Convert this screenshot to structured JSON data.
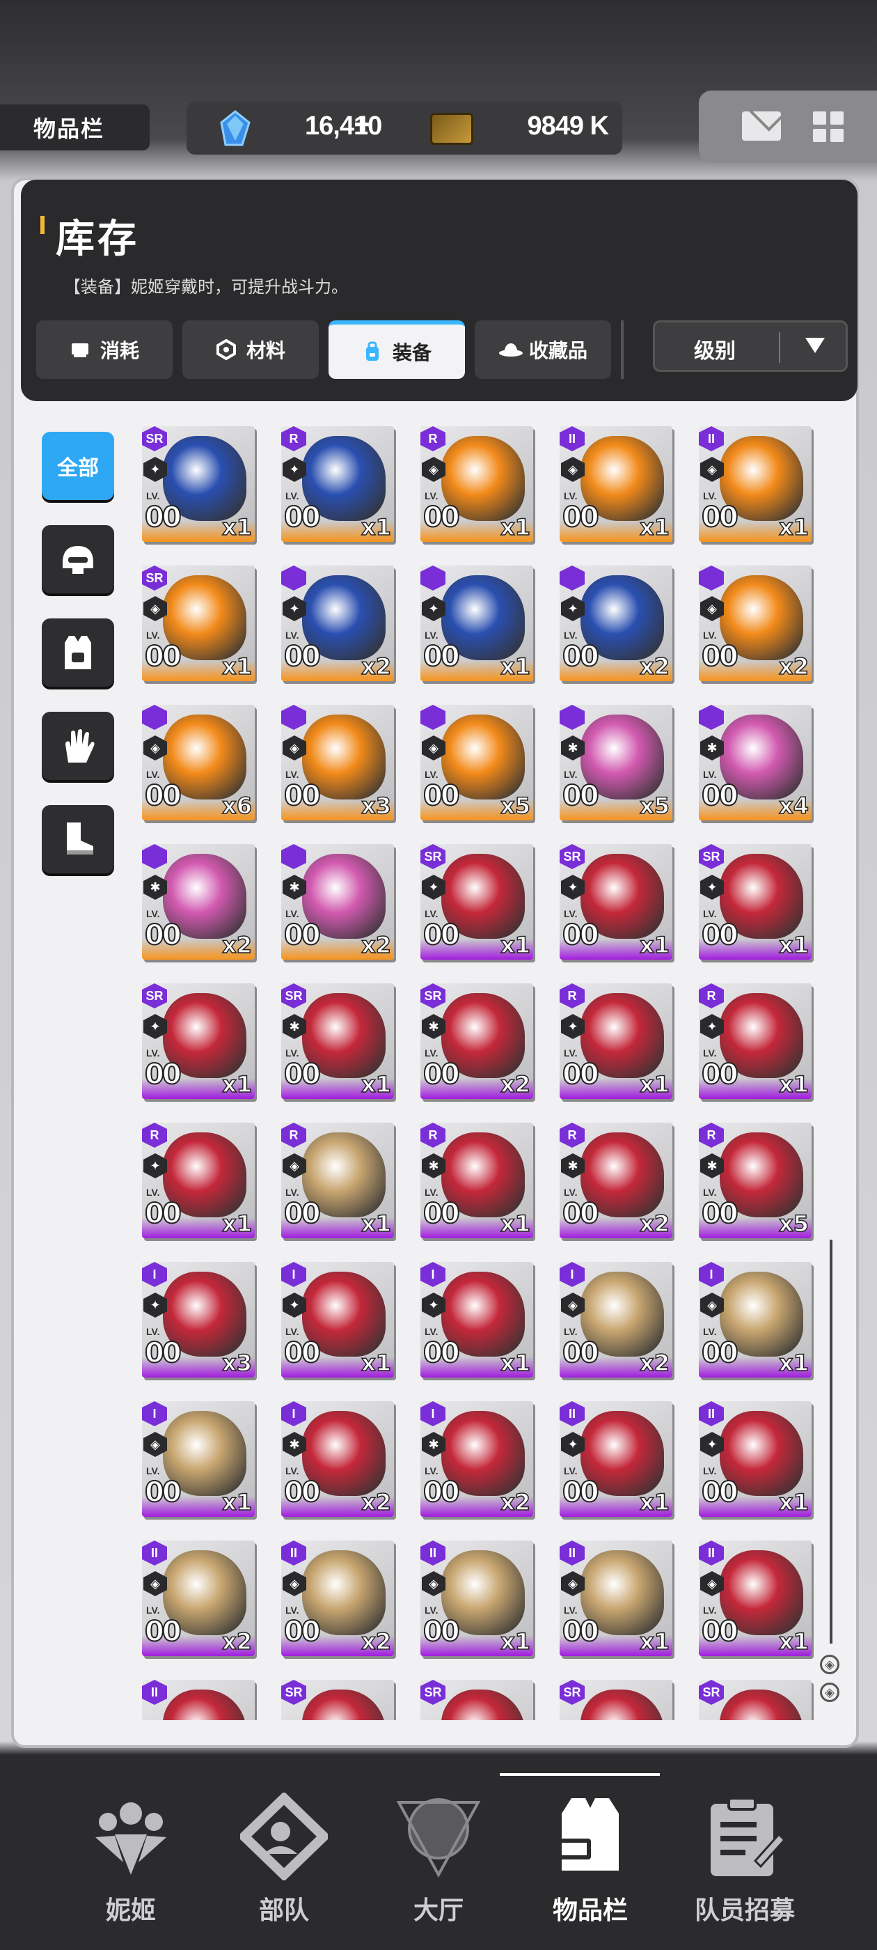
{
  "header": {
    "page_label": "物品栏",
    "gems": "16,410",
    "gems_plus": "+",
    "tickets": "9849 K"
  },
  "inventory": {
    "title": "库存",
    "description": "【装备】妮姬穿戴时，可提升战斗力。",
    "tabs": [
      {
        "label": "消耗",
        "icon": "consumable-icon",
        "active": false
      },
      {
        "label": "材料",
        "icon": "hexagon-icon",
        "active": false
      },
      {
        "label": "装备",
        "icon": "backpack-icon",
        "active": true
      },
      {
        "label": "收藏品",
        "icon": "hat-icon",
        "active": false
      }
    ],
    "sort_label": "级别"
  },
  "side_filters": [
    {
      "label": "全部",
      "icon": "",
      "active": true
    },
    {
      "label": "",
      "icon": "helmet-icon",
      "active": false
    },
    {
      "label": "",
      "icon": "vest-icon",
      "active": false
    },
    {
      "label": "",
      "icon": "glove-icon",
      "active": false
    },
    {
      "label": "",
      "icon": "boot-icon",
      "active": false
    }
  ],
  "items": [
    {
      "rarity": "orange",
      "rank": "SR",
      "cls": "✦",
      "lv": "LV.",
      "level": "00",
      "count": "x1",
      "color": "#2a4fb0"
    },
    {
      "rarity": "orange",
      "rank": "R",
      "cls": "✦",
      "lv": "LV.",
      "level": "00",
      "count": "x1",
      "color": "#2a4fb0"
    },
    {
      "rarity": "orange",
      "rank": "R",
      "cls": "◈",
      "lv": "LV.",
      "level": "00",
      "count": "x1",
      "color": "#f28a1a"
    },
    {
      "rarity": "orange",
      "rank": "II",
      "cls": "◈",
      "lv": "LV.",
      "level": "00",
      "count": "x1",
      "color": "#f28a1a"
    },
    {
      "rarity": "orange",
      "rank": "II",
      "cls": "◈",
      "lv": "LV.",
      "level": "00",
      "count": "x1",
      "color": "#f28a1a"
    },
    {
      "rarity": "orange",
      "rank": "SR",
      "cls": "◈",
      "lv": "LV.",
      "level": "00",
      "count": "x1",
      "color": "#f28a1a"
    },
    {
      "rarity": "orange",
      "rank": "",
      "cls": "✦",
      "lv": "LV.",
      "level": "00",
      "count": "x2",
      "color": "#2a4fb0"
    },
    {
      "rarity": "orange",
      "rank": "",
      "cls": "✦",
      "lv": "LV.",
      "level": "00",
      "count": "x1",
      "color": "#2a4fb0"
    },
    {
      "rarity": "orange",
      "rank": "",
      "cls": "✦",
      "lv": "LV.",
      "level": "00",
      "count": "x2",
      "color": "#2a4fb0"
    },
    {
      "rarity": "orange",
      "rank": "",
      "cls": "◈",
      "lv": "LV.",
      "level": "00",
      "count": "x2",
      "color": "#f28a1a"
    },
    {
      "rarity": "orange",
      "rank": "",
      "cls": "◈",
      "lv": "LV.",
      "level": "00",
      "count": "x6",
      "color": "#f28a1a"
    },
    {
      "rarity": "orange",
      "rank": "",
      "cls": "◈",
      "lv": "LV.",
      "level": "00",
      "count": "x3",
      "color": "#f28a1a"
    },
    {
      "rarity": "orange",
      "rank": "",
      "cls": "◈",
      "lv": "LV.",
      "level": "00",
      "count": "x5",
      "color": "#f28a1a"
    },
    {
      "rarity": "orange",
      "rank": "",
      "cls": "✱",
      "lv": "LV.",
      "level": "00",
      "count": "x5",
      "color": "#d25ab0"
    },
    {
      "rarity": "orange",
      "rank": "",
      "cls": "✱",
      "lv": "LV.",
      "level": "00",
      "count": "x4",
      "color": "#d25ab0"
    },
    {
      "rarity": "orange",
      "rank": "",
      "cls": "✱",
      "lv": "LV.",
      "level": "00",
      "count": "x2",
      "color": "#d25ab0"
    },
    {
      "rarity": "orange",
      "rank": "",
      "cls": "✱",
      "lv": "LV.",
      "level": "00",
      "count": "x2",
      "color": "#d25ab0"
    },
    {
      "rarity": "purple",
      "rank": "SR",
      "cls": "✦",
      "lv": "LV.",
      "level": "00",
      "count": "x1",
      "color": "#c4283a"
    },
    {
      "rarity": "purple",
      "rank": "SR",
      "cls": "✦",
      "lv": "LV.",
      "level": "00",
      "count": "x1",
      "color": "#c4283a"
    },
    {
      "rarity": "purple",
      "rank": "SR",
      "cls": "✦",
      "lv": "LV.",
      "level": "00",
      "count": "x1",
      "color": "#c4283a"
    },
    {
      "rarity": "purple",
      "rank": "SR",
      "cls": "✦",
      "lv": "LV.",
      "level": "00",
      "count": "x1",
      "color": "#c4283a"
    },
    {
      "rarity": "purple",
      "rank": "SR",
      "cls": "✱",
      "lv": "LV.",
      "level": "00",
      "count": "x1",
      "color": "#c4283a"
    },
    {
      "rarity": "purple",
      "rank": "SR",
      "cls": "✱",
      "lv": "LV.",
      "level": "00",
      "count": "x2",
      "color": "#c4283a"
    },
    {
      "rarity": "purple",
      "rank": "R",
      "cls": "✦",
      "lv": "LV.",
      "level": "00",
      "count": "x1",
      "color": "#c4283a"
    },
    {
      "rarity": "purple",
      "rank": "R",
      "cls": "✦",
      "lv": "LV.",
      "level": "00",
      "count": "x1",
      "color": "#c4283a"
    },
    {
      "rarity": "purple",
      "rank": "R",
      "cls": "✦",
      "lv": "LV.",
      "level": "00",
      "count": "x1",
      "color": "#c4283a"
    },
    {
      "rarity": "purple",
      "rank": "R",
      "cls": "◈",
      "lv": "LV.",
      "level": "00",
      "count": "x1",
      "color": "#c8a670"
    },
    {
      "rarity": "purple",
      "rank": "R",
      "cls": "✱",
      "lv": "LV.",
      "level": "00",
      "count": "x1",
      "color": "#c4283a"
    },
    {
      "rarity": "purple",
      "rank": "R",
      "cls": "✱",
      "lv": "LV.",
      "level": "00",
      "count": "x2",
      "color": "#c4283a"
    },
    {
      "rarity": "purple",
      "rank": "R",
      "cls": "✱",
      "lv": "LV.",
      "level": "00",
      "count": "x5",
      "color": "#c4283a"
    },
    {
      "rarity": "purple",
      "rank": "I",
      "cls": "✦",
      "lv": "LV.",
      "level": "00",
      "count": "x3",
      "color": "#c4283a"
    },
    {
      "rarity": "purple",
      "rank": "I",
      "cls": "✦",
      "lv": "LV.",
      "level": "00",
      "count": "x1",
      "color": "#c4283a"
    },
    {
      "rarity": "purple",
      "rank": "I",
      "cls": "✦",
      "lv": "LV.",
      "level": "00",
      "count": "x1",
      "color": "#c4283a"
    },
    {
      "rarity": "purple",
      "rank": "I",
      "cls": "◈",
      "lv": "LV.",
      "level": "00",
      "count": "x2",
      "color": "#c8a670"
    },
    {
      "rarity": "purple",
      "rank": "I",
      "cls": "◈",
      "lv": "LV.",
      "level": "00",
      "count": "x1",
      "color": "#c8a670"
    },
    {
      "rarity": "purple",
      "rank": "I",
      "cls": "◈",
      "lv": "LV.",
      "level": "00",
      "count": "x1",
      "color": "#c8a670"
    },
    {
      "rarity": "purple",
      "rank": "I",
      "cls": "✱",
      "lv": "LV.",
      "level": "00",
      "count": "x2",
      "color": "#c4283a"
    },
    {
      "rarity": "purple",
      "rank": "I",
      "cls": "✱",
      "lv": "LV.",
      "level": "00",
      "count": "x2",
      "color": "#c4283a"
    },
    {
      "rarity": "purple",
      "rank": "II",
      "cls": "✦",
      "lv": "LV.",
      "level": "00",
      "count": "x1",
      "color": "#c4283a"
    },
    {
      "rarity": "purple",
      "rank": "II",
      "cls": "✦",
      "lv": "LV.",
      "level": "00",
      "count": "x1",
      "color": "#c4283a"
    },
    {
      "rarity": "purple",
      "rank": "II",
      "cls": "◈",
      "lv": "LV.",
      "level": "00",
      "count": "x2",
      "color": "#c8a670"
    },
    {
      "rarity": "purple",
      "rank": "II",
      "cls": "◈",
      "lv": "LV.",
      "level": "00",
      "count": "x2",
      "color": "#c8a670"
    },
    {
      "rarity": "purple",
      "rank": "II",
      "cls": "◈",
      "lv": "LV.",
      "level": "00",
      "count": "x1",
      "color": "#c8a670"
    },
    {
      "rarity": "purple",
      "rank": "II",
      "cls": "◈",
      "lv": "LV.",
      "level": "00",
      "count": "x1",
      "color": "#c8a670"
    },
    {
      "rarity": "purple",
      "rank": "II",
      "cls": "◈",
      "lv": "LV.",
      "level": "00",
      "count": "x1",
      "color": "#c4283a"
    },
    {
      "rarity": "purple",
      "rank": "II",
      "cls": "",
      "lv": "",
      "level": "",
      "count": "",
      "color": "#c4283a"
    },
    {
      "rarity": "purple",
      "rank": "SR",
      "cls": "",
      "lv": "",
      "level": "",
      "count": "",
      "color": "#c4283a"
    },
    {
      "rarity": "purple",
      "rank": "SR",
      "cls": "",
      "lv": "",
      "level": "",
      "count": "",
      "color": "#c4283a"
    },
    {
      "rarity": "purple",
      "rank": "SR",
      "cls": "",
      "lv": "",
      "level": "",
      "count": "",
      "color": "#c4283a"
    },
    {
      "rarity": "purple",
      "rank": "SR",
      "cls": "",
      "lv": "",
      "level": "",
      "count": "",
      "color": "#c4283a"
    }
  ],
  "nav": [
    {
      "label": "妮姬",
      "icon": "nikke-icon",
      "active": false
    },
    {
      "label": "部队",
      "icon": "squad-icon",
      "active": false
    },
    {
      "label": "大厅",
      "icon": "lobby-icon",
      "active": false
    },
    {
      "label": "物品栏",
      "icon": "inventory-icon",
      "active": true
    },
    {
      "label": "队员招募",
      "icon": "recruit-icon",
      "active": false
    }
  ]
}
